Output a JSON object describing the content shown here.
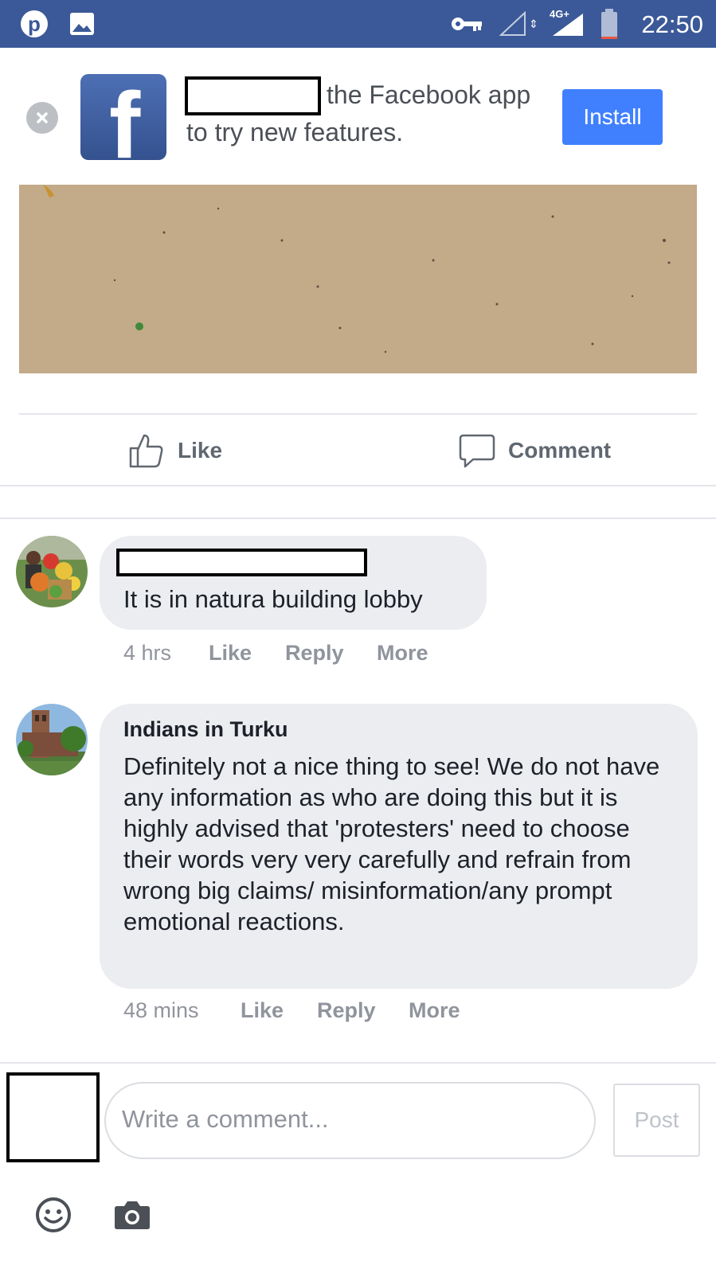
{
  "status_bar": {
    "time": "22:50",
    "network": "4G+",
    "icons": [
      "pinterest-icon",
      "image-icon",
      "key-icon",
      "signal-empty-icon",
      "signal-icon",
      "battery-icon"
    ],
    "background_color": "#3b5998"
  },
  "install_banner": {
    "logo_letter": "f",
    "text_line1": "the Facebook app",
    "text_line2": "to try new features.",
    "install_label": "Install",
    "accent_color": "#4080ff"
  },
  "post_actions": {
    "like_label": "Like",
    "comment_label": "Comment"
  },
  "comments": [
    {
      "author": "",
      "text": "It is in natura building lobby",
      "time": "4 hrs",
      "like_label": "Like",
      "reply_label": "Reply",
      "more_label": "More"
    },
    {
      "author": "Indians in Turku",
      "text": "Definitely not a nice thing to see! We do not have any information as who are doing this but it is highly advised that 'protesters' need to choose their words very very carefully and refrain from wrong big claims/ misinformation/any prompt emotional reactions.",
      "time": "48 mins",
      "like_label": "Like",
      "reply_label": "Reply",
      "more_label": "More"
    }
  ],
  "composer": {
    "placeholder": "Write a comment...",
    "post_label": "Post",
    "tools": [
      "emoji-icon",
      "camera-icon"
    ]
  }
}
